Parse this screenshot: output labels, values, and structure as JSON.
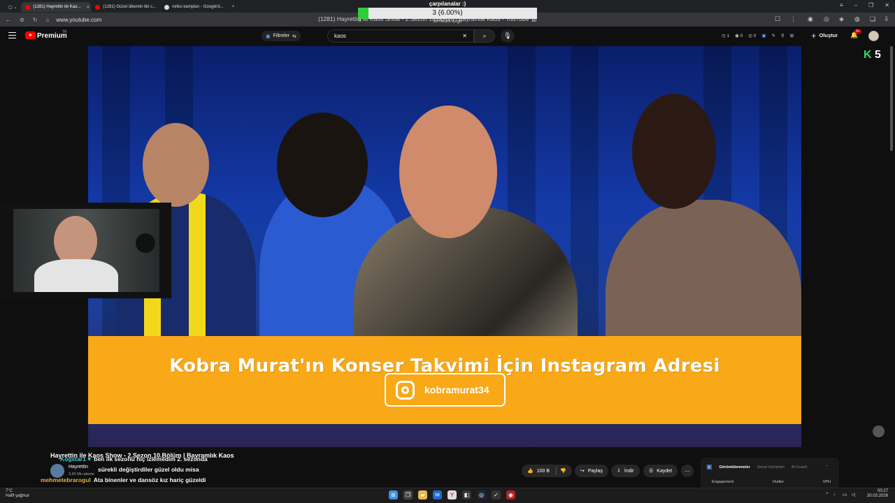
{
  "browser": {
    "tabs": [
      {
        "label": "(1281) Hayrettin ile Kao...",
        "active": true,
        "icon": "youtube-icon"
      },
      {
        "label": "(1281) Güzel ülkemin tiki c...",
        "active": false,
        "icon": "youtube-icon"
      },
      {
        "label": "nefes kampları - Google'd...",
        "active": false,
        "icon": "google-icon"
      }
    ],
    "new_tab": "+",
    "url": "www.youtube.com",
    "page_title": "(1281) Hayrettin ile Kaos Show - 2.Sezon 10.Bölüm | Bayramlık Kaos - YouTube"
  },
  "poll": {
    "title": "çarpılanalar :)",
    "value": "3 (6.00%)",
    "fraction": 0.06,
    "min": "0",
    "max": "50",
    "sub": "36 hours to go"
  },
  "youtube": {
    "brand": "Premium",
    "region": "TR",
    "filters": "Filtreler",
    "search_value": "kaos",
    "clear": "✕",
    "stats": [
      "1",
      "0",
      "0"
    ],
    "create": "Oluştur",
    "notif_count": "9+"
  },
  "video": {
    "banner_text": "Kobra Murat'ın Konser Takvimi İçin Instagram Adresi",
    "ig_handle": "kobramurat34",
    "channel_logo": "5"
  },
  "below": {
    "title": "Hayrettin ile Kaos Show - 2.Sezon 10.Bölüm | Bayramlık Kaos",
    "channel": "Hayrettin",
    "subs": "3,42 Mn abone",
    "likes": "100 B",
    "share": "Paylaş",
    "download": "İndir",
    "save": "Kaydet"
  },
  "chat": [
    {
      "user": "Kogstar1 ♥",
      "text": "ben ilk sezonu hiç izlemedim 2. sezonda"
    },
    {
      "user": "",
      "text": "sürekli değiştirdiler güzel oldu misa"
    },
    {
      "user": "mehmetebrarogul",
      "text": "Ata binenler ve dansöz kız hariç güzeldi"
    }
  ],
  "panel": {
    "tabs": [
      "Görüntülenmeler",
      "Genel Görünüm",
      "AI Coach"
    ],
    "cols": [
      "Engagement",
      "Outlier",
      "VPH"
    ]
  },
  "taskbar": {
    "temp": "7°C",
    "weather": "Hafif yağmur",
    "time": "00:27",
    "date": "30.03.2026"
  },
  "colors": {
    "banner": "#f9a818",
    "poll_fill": "#2fcf3a",
    "yt_red": "#ff0000",
    "chat_user": "#4fd0d6"
  }
}
